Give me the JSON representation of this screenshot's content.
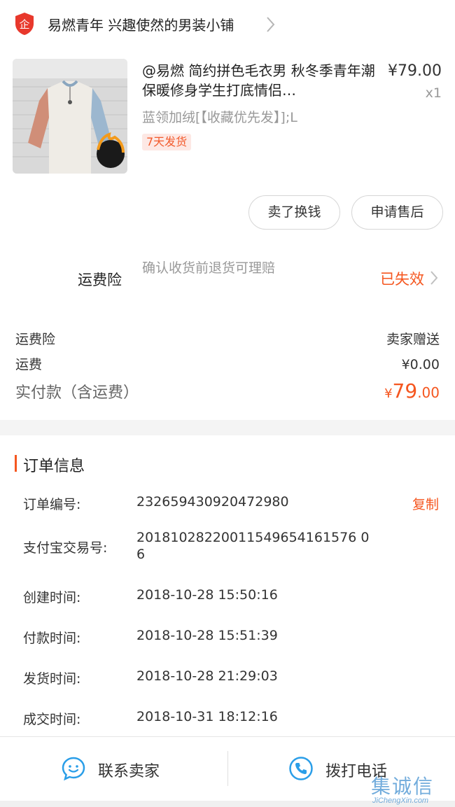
{
  "shop": {
    "badge_icon": "enterprise-shield-icon",
    "badge_char": "企",
    "name": "易燃青年 兴趣使然的男装小铺"
  },
  "product": {
    "title": "@易燃 简约拼色毛衣男 秋冬季青年潮保暖修身学生打底情侣…",
    "sku": "蓝领加绒[【收藏优先发】];L",
    "ship_tag": "7天发货",
    "price": "¥79.00",
    "qty": "x1"
  },
  "actions": {
    "sell_label": "卖了换钱",
    "aftersale_label": "申请售后"
  },
  "insurance": {
    "label": "运费险",
    "desc": "确认收货前退货可理赔",
    "status": "已失效"
  },
  "fees": {
    "insurance_label": "运费险",
    "insurance_value": "卖家赠送",
    "shipping_label": "运费",
    "shipping_value": "¥0.00",
    "total_label": "实付款（含运费）",
    "total_currency": "¥",
    "total_int": "79",
    "total_dec": ".00"
  },
  "order_info": {
    "title": "订单信息",
    "copy_label": "复制",
    "rows": [
      {
        "label": "订单编号:",
        "value": "232659430920472980"
      },
      {
        "label": "支付宝交易号:",
        "value": "20181028220011549654161576 06"
      },
      {
        "label": "创建时间:",
        "value": "2018-10-28 15:50:16"
      },
      {
        "label": "付款时间:",
        "value": "2018-10-28 15:51:39"
      },
      {
        "label": "发货时间:",
        "value": "2018-10-28 21:29:03"
      },
      {
        "label": "成交时间:",
        "value": "2018-10-31 18:12:16"
      }
    ]
  },
  "bottom": {
    "contact_label": "联系卖家",
    "phone_label": "拨打电话"
  },
  "watermark": {
    "glyphs": "集诚信",
    "text": "JiChengXin.com"
  },
  "colors": {
    "accent": "#f5561f",
    "shop_badge": "#e8382c",
    "icon_blue": "#2a9ee8"
  }
}
